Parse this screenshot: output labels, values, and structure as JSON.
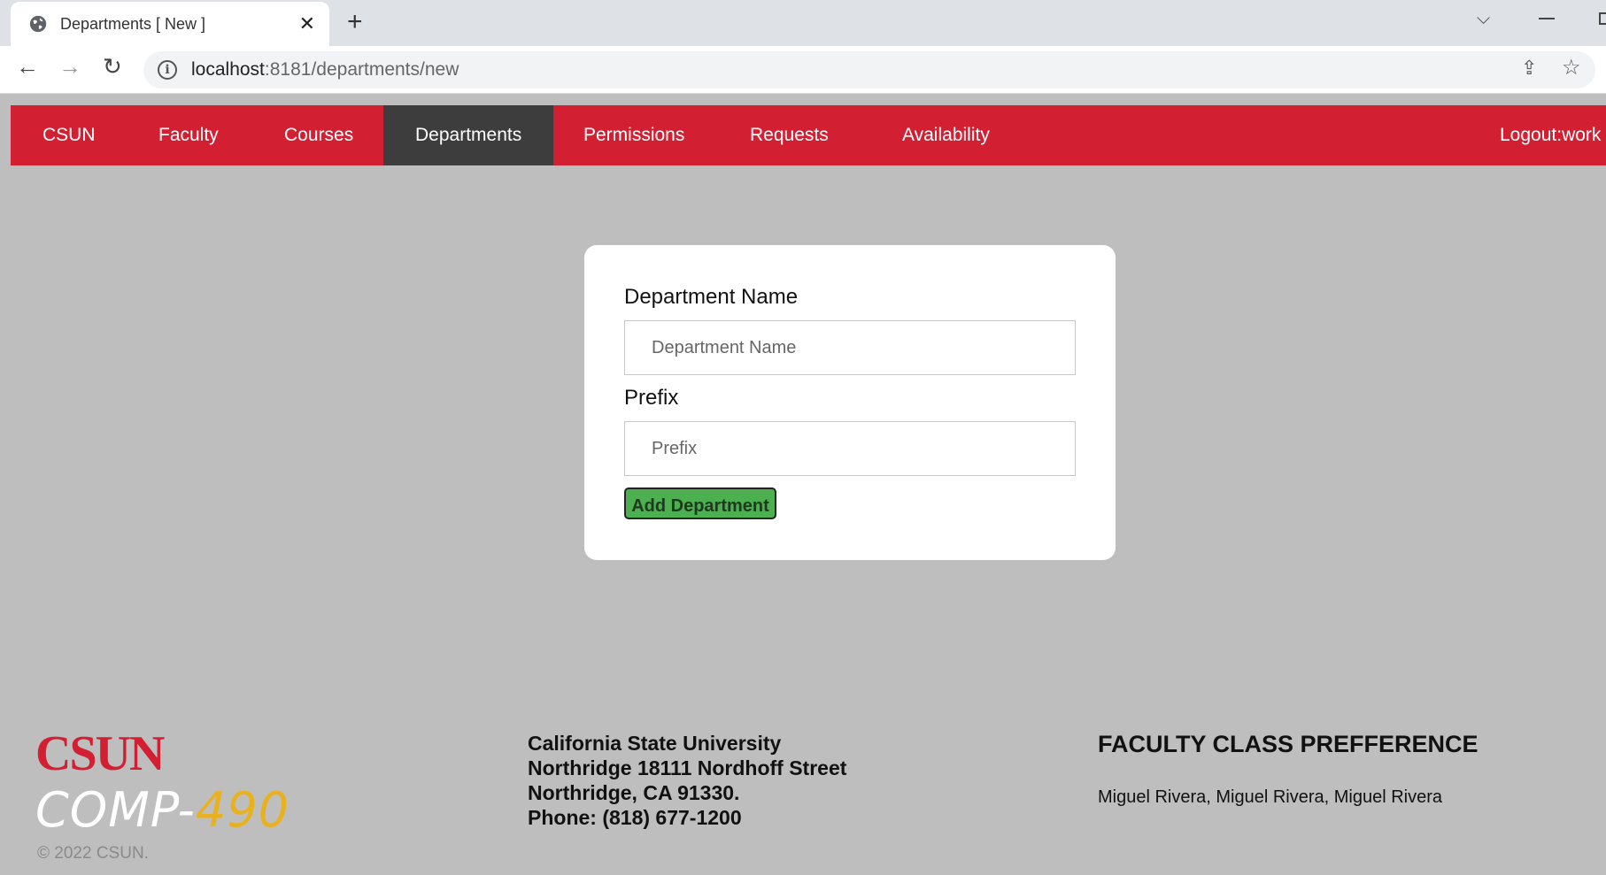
{
  "browser": {
    "tab_title": "Departments [ New ]",
    "url_host": "localhost",
    "url_path": ":8181/departments/new"
  },
  "nav": {
    "items": [
      "CSUN",
      "Faculty",
      "Courses",
      "Departments",
      "Permissions",
      "Requests",
      "Availability"
    ],
    "active": "Departments",
    "logout": "Logout:work"
  },
  "form": {
    "name_label": "Department Name",
    "name_placeholder": "Department Name",
    "name_value": "",
    "prefix_label": "Prefix",
    "prefix_placeholder": "Prefix",
    "prefix_value": "",
    "submit_label": "Add Department"
  },
  "footer": {
    "logo": "CSUN",
    "course_a": "COMP-",
    "course_b": "490",
    "copyright": "© 2022 CSUN.",
    "address": [
      "California State University",
      "Northridge 18111 Nordhoff Street",
      "Northridge, CA 91330.",
      "Phone: (818) 677-1200"
    ],
    "title": "FACULTY CLASS PREFFERENCE",
    "names": "Miguel Rivera, Miguel Rivera, Miguel Rivera"
  },
  "colors": {
    "brand_red": "#d31f32",
    "nav_active": "#3d3d3d",
    "button_green": "#4caf50",
    "page_bg": "#bebebe",
    "comp_yellow": "#e9b11c"
  },
  "icons": [
    "globe-icon",
    "close-icon",
    "plus-icon",
    "chevron-down-icon",
    "minimize-icon",
    "maximize-icon",
    "back-arrow-icon",
    "forward-arrow-icon",
    "reload-icon",
    "info-icon",
    "share-icon",
    "star-icon"
  ]
}
